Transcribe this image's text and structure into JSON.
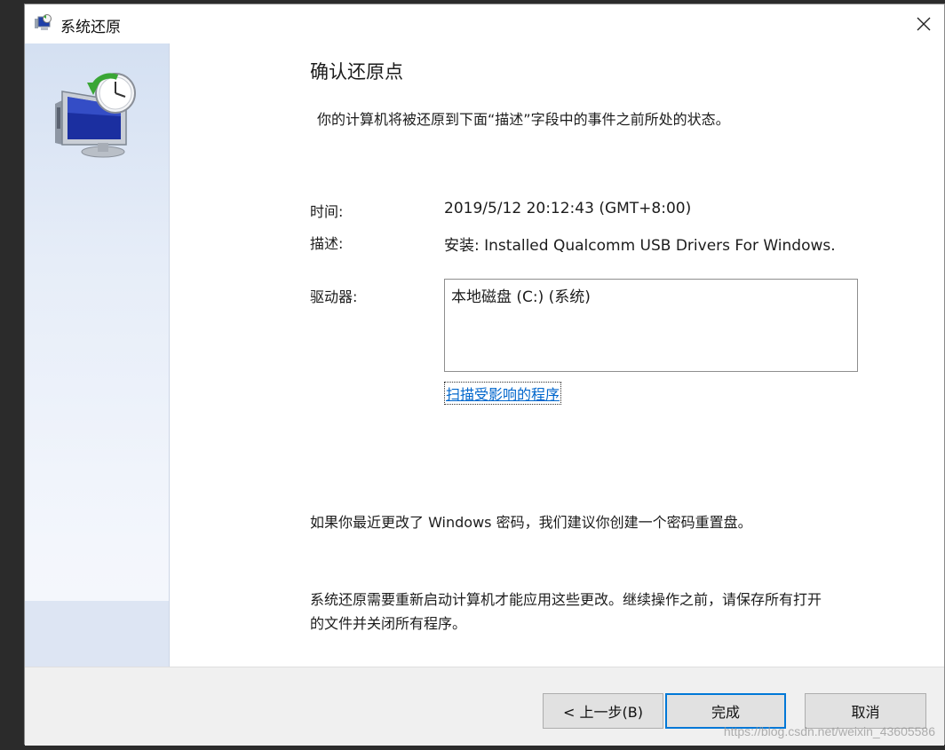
{
  "window": {
    "title": "系统还原",
    "close_label": "✕"
  },
  "header": {
    "heading": "确认还原点",
    "intro": "你的计算机将被还原到下面“描述”字段中的事件之前所处的状态。"
  },
  "details": {
    "time_label": "时间:",
    "time_value": "2019/5/12 20:12:43 (GMT+8:00)",
    "desc_label": "描述:",
    "desc_value": "安装: Installed Qualcomm USB Drivers For Windows.",
    "drives_label": "驱动器:",
    "drives": [
      "本地磁盘 (C:) (系统)"
    ],
    "scan_link": "扫描受影响的程序"
  },
  "notes": {
    "password_note": "如果你最近更改了 Windows 密码，我们建议你创建一个密码重置盘。",
    "restart_note_line1": "系统还原需要重新启动计算机才能应用这些更改。继续操作之前，请保存所有打开",
    "restart_note_line2": "的文件并关闭所有程序。"
  },
  "buttons": {
    "back": "< 上一步(B)",
    "finish": "完成",
    "cancel": "取消"
  },
  "watermark": "https://blog.csdn.net/weixin_43605586",
  "colors": {
    "accent": "#0078d7",
    "link": "#0066cc",
    "sidebar_top": "#d4e0f2"
  },
  "icons": {
    "title": "system-restore-icon",
    "close": "close-icon",
    "sidebar": "system-restore-monitor-clock-icon"
  }
}
